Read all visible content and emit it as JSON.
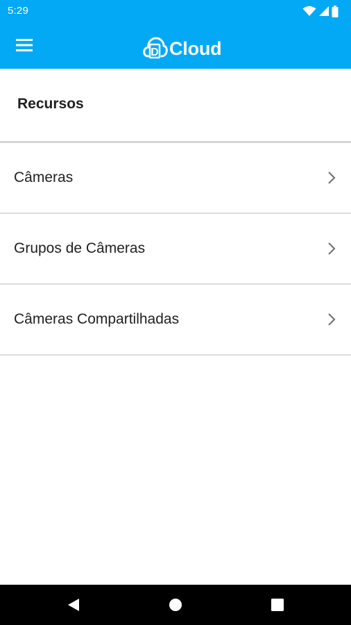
{
  "status_bar": {
    "time": "5:29",
    "icons": [
      "wifi-icon",
      "cell-signal-icon",
      "battery-icon"
    ]
  },
  "app_bar": {
    "menu_icon": "hamburger-menu-icon",
    "logo": {
      "mark": "D",
      "text": "Cloud"
    },
    "background_color": "#03a9f4"
  },
  "section": {
    "title": "Recursos"
  },
  "items": [
    {
      "label": "Câmeras",
      "icon": "chevron-right-icon"
    },
    {
      "label": "Grupos de Câmeras",
      "icon": "chevron-right-icon"
    },
    {
      "label": "Câmeras Compartilhadas",
      "icon": "chevron-right-icon"
    }
  ],
  "nav_bar": {
    "buttons": [
      "back-icon",
      "home-icon",
      "recents-icon"
    ]
  }
}
